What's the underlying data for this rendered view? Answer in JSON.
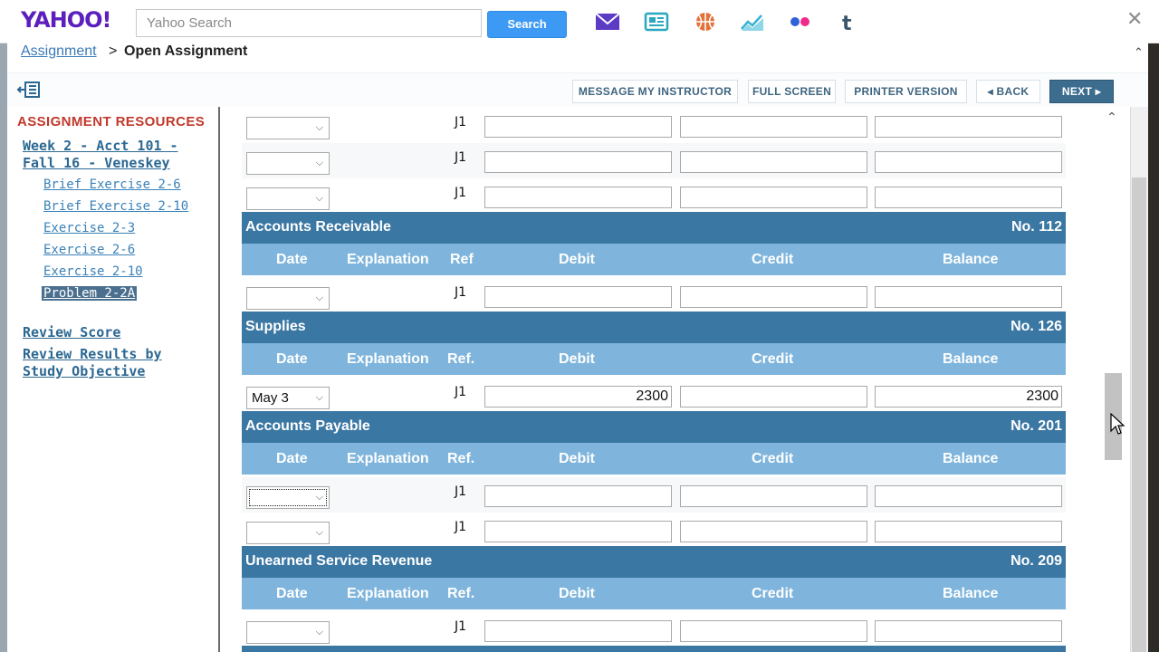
{
  "yahoo": {
    "logo": "YAHOO!",
    "search_placeholder": "Yahoo Search",
    "search_button": "Search",
    "icons": [
      "mail-icon",
      "news-icon",
      "sports-icon",
      "finance-icon",
      "flickr-icon",
      "tumblr-icon"
    ],
    "close": "✕"
  },
  "breadcrumb": {
    "link": "Assignment",
    "separator": ">",
    "current": "Open Assignment"
  },
  "toolbar": {
    "message": "MESSAGE MY INSTRUCTOR",
    "fullscreen": "FULL SCREEN",
    "printer": "PRINTER VERSION",
    "back": "◂ BACK",
    "next": "NEXT ▸"
  },
  "sidebar": {
    "title": "ASSIGNMENT RESOURCES",
    "course_line1": "Week 2 - Acct 101 -",
    "course_line2": "Fall 16 - Veneskey",
    "links": [
      "Brief Exercise 2-6",
      "Brief Exercise 2-10",
      "Exercise 2-3",
      "Exercise 2-6",
      "Exercise 2-10",
      "Problem 2-2A"
    ],
    "review_score": "Review Score",
    "review_results_1": "Review Results by",
    "review_results_2": "Study Objective"
  },
  "ledger": {
    "ref": "J1",
    "columns_a": {
      "date": "Date",
      "explanation": "Explanation",
      "ref": "Ref",
      "debit": "Debit",
      "credit": "Credit",
      "balance": "Balance"
    },
    "columns_b": {
      "date": "Date",
      "explanation": "Explanation",
      "ref": "Ref.",
      "debit": "Debit",
      "credit": "Credit",
      "balance": "Balance"
    },
    "accounts": {
      "ar": {
        "name": "Accounts Receivable",
        "no": "No. 112"
      },
      "supplies": {
        "name": "Supplies",
        "no": "No. 126"
      },
      "ap": {
        "name": "Accounts Payable",
        "no": "No. 201"
      },
      "usr": {
        "name": "Unearned Service Revenue",
        "no": "No. 209"
      }
    },
    "supplies_row": {
      "date": "May 3",
      "debit": "2300",
      "credit": "",
      "balance": "2300"
    }
  },
  "colors": {
    "account_header": "#3b77a3",
    "column_header": "#7fb5dc",
    "sidebar_title": "#c0392b",
    "next_button": "#3c6c8e"
  }
}
